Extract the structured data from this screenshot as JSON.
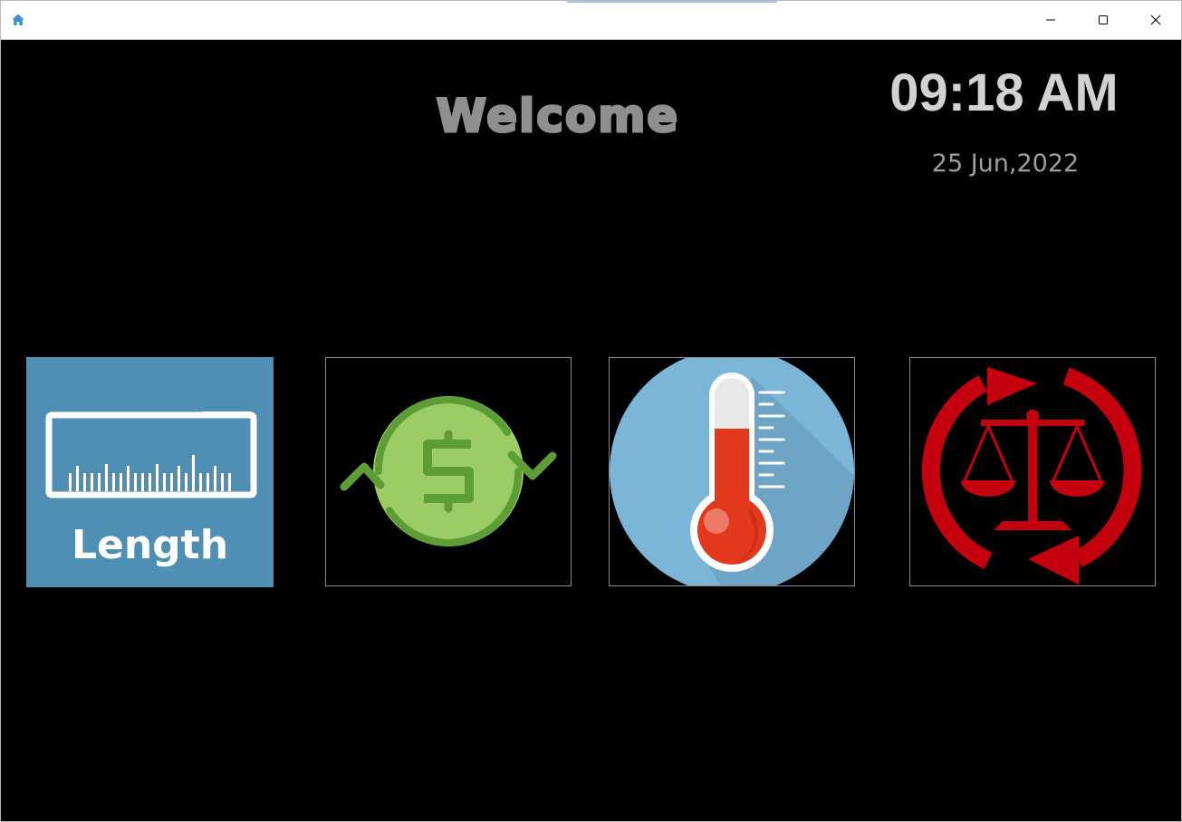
{
  "window": {
    "minimize_glyph": "—",
    "maximize_glyph": "☐",
    "close_glyph": "✕"
  },
  "header": {
    "welcome": "Welcome",
    "time": "09:18 AM",
    "date": "25 Jun,2022"
  },
  "tiles": [
    {
      "id": "length",
      "label": "Length",
      "icon": "ruler-icon",
      "bg": "#4f8fb3"
    },
    {
      "id": "currency",
      "icon": "currency-exchange-icon"
    },
    {
      "id": "temperature",
      "icon": "thermometer-icon"
    },
    {
      "id": "weight",
      "icon": "scale-exchange-icon"
    }
  ],
  "colors": {
    "background": "#000000",
    "welcome": "#8f8f8f",
    "clock": "#d2d2d2",
    "date": "#9e9e9e",
    "length_tile": "#4f8fb3",
    "currency_green": "#9ccc65",
    "currency_dark_green": "#5e9c35",
    "thermo_blue": "#7bb6d8",
    "thermo_red": "#e2381e",
    "scale_red": "#c4000f"
  }
}
